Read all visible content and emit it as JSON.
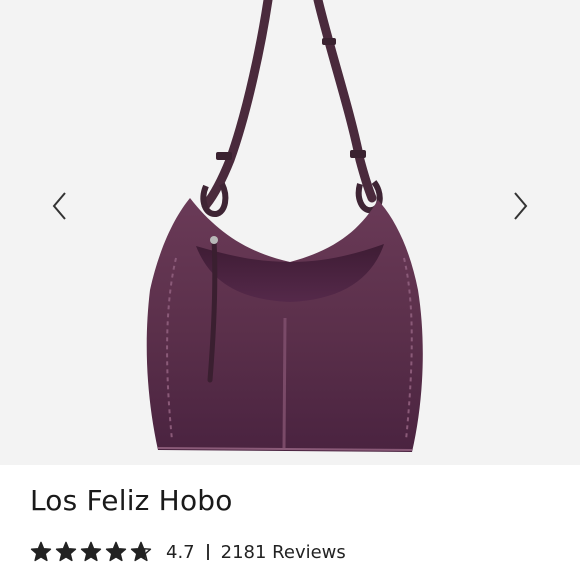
{
  "product": {
    "title": "Los Feliz Hobo",
    "rating": "4.7",
    "rating_value": 4.7,
    "stars_total": 5,
    "reviews": "2181 Reviews"
  },
  "gallery": {
    "prev_icon": "chevron-left-icon",
    "next_icon": "chevron-right-icon"
  },
  "colors": {
    "gallery_bg": "#f3f3f3",
    "bag_suede": "#5a3048",
    "text": "#1a1a1a"
  }
}
